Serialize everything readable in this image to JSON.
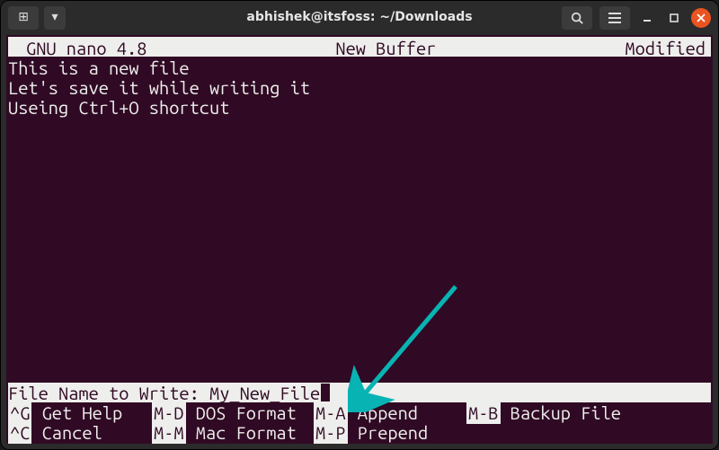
{
  "window": {
    "title": "abhishek@itsfoss: ~/Downloads"
  },
  "titlebar": {
    "new_tab_icon": "⊞",
    "dropdown_icon": "▾"
  },
  "editor": {
    "header": {
      "app": "GNU nano 4.8",
      "buffer": "New Buffer",
      "status": "Modified"
    },
    "lines": {
      "l1": "This is a new file",
      "l2": "Let's save it while writing it",
      "l3": "Useing Ctrl+O shortcut"
    },
    "prompt": {
      "label": "File Name to Write: ",
      "value": "My_New_File"
    },
    "shortcuts": {
      "r1": {
        "k1": "^G",
        "t1": " Get Help",
        "k2": "M-D",
        "t2": " DOS Format",
        "k3": "M-A",
        "t3": " Append",
        "k4": "M-B",
        "t4": " Backup File"
      },
      "r2": {
        "k1": "^C",
        "t1": " Cancel",
        "k2": "M-M",
        "t2": " Mac Format",
        "k3": "M-P",
        "t3": " Prepend",
        "k4": "",
        "t4": ""
      }
    }
  },
  "arrow_color": "#08b3b3"
}
